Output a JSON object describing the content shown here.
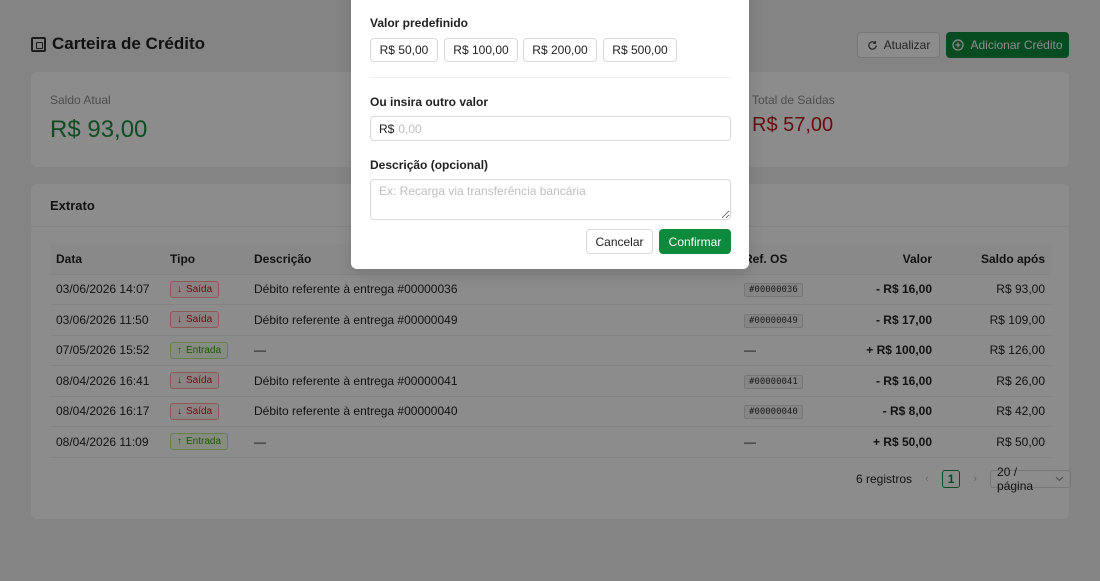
{
  "header": {
    "title": "Carteira de Crédito",
    "refresh_label": "Atualizar",
    "add_label": "Adicionar Crédito"
  },
  "stats": {
    "balance_label": "Saldo Atual",
    "balance_value": "R$ 93,00",
    "outflows_label": "Total de Saídas",
    "outflows_value": "R$ 57,00"
  },
  "extract": {
    "title": "Extrato",
    "columns": [
      "Data",
      "Tipo",
      "Descrição",
      "Ref. OS",
      "Valor",
      "Saldo após"
    ],
    "rows": [
      {
        "date": "03/06/2026 14:07",
        "type": "Saída",
        "kind": "out",
        "description": "Débito referente à entrega #00000036",
        "ref": "#00000036",
        "value": "- R$ 16,00",
        "balance": "R$ 93,00"
      },
      {
        "date": "03/06/2026 11:50",
        "type": "Saída",
        "kind": "out",
        "description": "Débito referente à entrega #00000049",
        "ref": "#00000049",
        "value": "- R$ 17,00",
        "balance": "R$ 109,00"
      },
      {
        "date": "07/05/2026 15:52",
        "type": "Entrada",
        "kind": "in",
        "description": "—",
        "ref": "—",
        "value": "+ R$ 100,00",
        "balance": "R$ 126,00"
      },
      {
        "date": "08/04/2026 16:41",
        "type": "Saída",
        "kind": "out",
        "description": "Débito referente à entrega #00000041",
        "ref": "#00000041",
        "value": "- R$ 16,00",
        "balance": "R$ 26,00"
      },
      {
        "date": "08/04/2026 16:17",
        "type": "Saída",
        "kind": "out",
        "description": "Débito referente à entrega #00000040",
        "ref": "#00000040",
        "value": "- R$ 8,00",
        "balance": "R$ 42,00"
      },
      {
        "date": "08/04/2026 11:09",
        "type": "Entrada",
        "kind": "in",
        "description": "—",
        "ref": "—",
        "value": "+ R$ 50,00",
        "balance": "R$ 50,00"
      }
    ],
    "pagination": {
      "total": "6 registros",
      "current_page": "1",
      "page_size": "20 / página"
    }
  },
  "modal": {
    "preset_label": "Valor predefinido",
    "presets": [
      "R$ 50,00",
      "R$ 100,00",
      "R$ 200,00",
      "R$ 500,00"
    ],
    "other_label": "Ou insira outro valor",
    "currency_prefix": "R$",
    "amount_placeholder": "0,00",
    "description_label": "Descrição (opcional)",
    "description_placeholder": "Ex: Recarga via transferência bancária",
    "cancel_label": "Cancelar",
    "confirm_label": "Confirmar"
  },
  "colors": {
    "primary": "#0e8a3c",
    "positive": "#1e8a3e",
    "negative": "#b81d1d"
  }
}
